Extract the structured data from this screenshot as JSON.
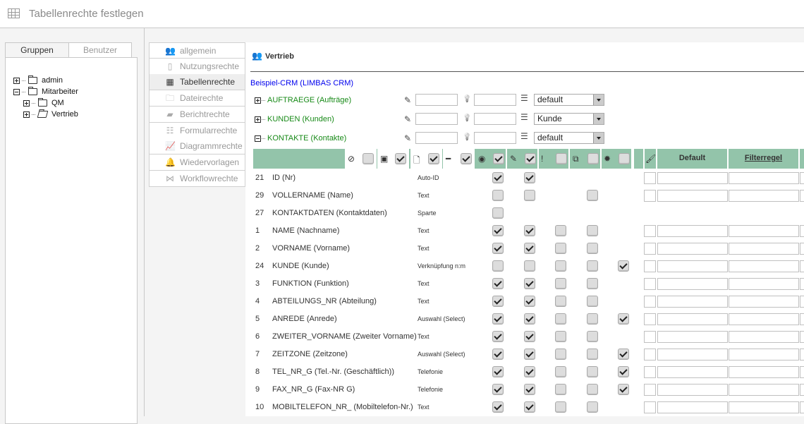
{
  "window": {
    "title": "Tabellenrechte festlegen",
    "icon": "table-icon"
  },
  "left_tabs": [
    {
      "label": "Gruppen",
      "active": true
    },
    {
      "label": "Benutzer",
      "active": false
    }
  ],
  "tree": [
    {
      "label": "admin",
      "expanded": false,
      "level": 0,
      "icon": "folder-icon"
    },
    {
      "label": "Mitarbeiter",
      "expanded": true,
      "level": 0,
      "icon": "folder-icon"
    },
    {
      "label": "QM",
      "expanded": false,
      "level": 1,
      "icon": "folder-icon"
    },
    {
      "label": "Vertrieb",
      "expanded": false,
      "level": 1,
      "icon": "folder-open-icon"
    }
  ],
  "menu": [
    {
      "label": "allgemein",
      "icon": "users-icon"
    },
    {
      "label": "Nutzungsrechte",
      "icon": "tablet-icon"
    },
    {
      "label": "Tabellenrechte",
      "icon": "table-icon",
      "active": true
    },
    {
      "label": "Dateirechte",
      "icon": "folder-icon"
    },
    {
      "label": "Berichtrechte",
      "icon": "book-icon"
    },
    {
      "label": "Formularrechte",
      "icon": "form-icon"
    },
    {
      "label": "Diagrammrechte",
      "icon": "chart-icon"
    },
    {
      "label": "Wiedervorlagen",
      "icon": "bell-icon"
    },
    {
      "label": "Workflowrechte",
      "icon": "workflow-icon"
    }
  ],
  "group_title": "Vertrieb",
  "database": "Beispiel-CRM (LIMBAS CRM)",
  "tables": [
    {
      "label": "AUFTRAEGE (Aufträge)",
      "expanded": false,
      "select": "default"
    },
    {
      "label": "KUNDEN (Kunden)",
      "expanded": false,
      "select": "Kunde"
    },
    {
      "label": "KONTAKTE (Kontakte)",
      "expanded": true,
      "select": "default"
    }
  ],
  "header": {
    "white_cols": [
      {
        "icon": "eye-slash-icon",
        "glyph": "⊘",
        "checked": false
      },
      {
        "icon": "save-icon",
        "glyph": "▣",
        "checked": true
      },
      {
        "icon": "add-file-icon",
        "glyph": "🗋",
        "checked": true
      },
      {
        "icon": "minus-icon",
        "glyph": "━",
        "checked": true
      }
    ],
    "green_cols": [
      {
        "icon": "eye-icon",
        "glyph": "◉",
        "checked": true
      },
      {
        "icon": "pencil-icon",
        "glyph": "✎",
        "checked": true
      },
      {
        "icon": "exclamation-icon",
        "glyph": "!",
        "checked": false
      },
      {
        "icon": "copy-icon",
        "glyph": "⧉",
        "checked": false
      },
      {
        "icon": "gear-icon",
        "glyph": "✹",
        "checked": false
      }
    ],
    "brush_icon": "brush-icon",
    "default_label": "Default",
    "filter_label": "Filterregel"
  },
  "colors": {
    "header_green": "#93c4aa",
    "table_green": "#188a18",
    "link_blue": "#0000ee"
  },
  "rows": [
    {
      "num": "21",
      "field": "ID (Nr)",
      "type": "Auto-ID",
      "cbs": [
        true,
        true,
        null,
        null,
        null
      ],
      "inputs": true
    },
    {
      "num": "29",
      "field": "VOLLERNAME (Name)",
      "type": "Text",
      "cbs": [
        false,
        false,
        null,
        false,
        null
      ],
      "inputs": true
    },
    {
      "num": "27",
      "field": "KONTAKTDATEN (Kontaktdaten)",
      "type": "Sparte",
      "cbs": [
        false,
        null,
        null,
        null,
        null
      ],
      "inputs": false
    },
    {
      "num": "1",
      "field": "NAME (Nachname)",
      "type": "Text",
      "cbs": [
        true,
        true,
        false,
        false,
        null
      ],
      "inputs": true
    },
    {
      "num": "2",
      "field": "VORNAME (Vorname)",
      "type": "Text",
      "cbs": [
        true,
        true,
        false,
        false,
        null
      ],
      "inputs": true
    },
    {
      "num": "24",
      "field": "KUNDE (Kunde)",
      "type": "Verknüpfung n:m",
      "cbs": [
        false,
        false,
        false,
        false,
        true
      ],
      "inputs": true
    },
    {
      "num": "3",
      "field": "FUNKTION (Funktion)",
      "type": "Text",
      "cbs": [
        true,
        true,
        false,
        false,
        null
      ],
      "inputs": true
    },
    {
      "num": "4",
      "field": "ABTEILUNGS_NR (Abteilung)",
      "type": "Text",
      "cbs": [
        true,
        true,
        false,
        false,
        null
      ],
      "inputs": true
    },
    {
      "num": "5",
      "field": "ANREDE (Anrede)",
      "type": "Auswahl (Select)",
      "cbs": [
        true,
        true,
        false,
        false,
        true
      ],
      "inputs": true
    },
    {
      "num": "6",
      "field": "ZWEITER_VORNAME (Zweiter Vorname)",
      "type": "Text",
      "cbs": [
        true,
        true,
        false,
        false,
        null
      ],
      "inputs": true
    },
    {
      "num": "7",
      "field": "ZEITZONE (Zeitzone)",
      "type": "Auswahl (Select)",
      "cbs": [
        true,
        true,
        false,
        false,
        true
      ],
      "inputs": true
    },
    {
      "num": "8",
      "field": "TEL_NR_G (Tel.-Nr. (Geschäftlich))",
      "type": "Telefonie",
      "cbs": [
        true,
        true,
        false,
        false,
        true
      ],
      "inputs": true
    },
    {
      "num": "9",
      "field": "FAX_NR_G (Fax-NR G)",
      "type": "Telefonie",
      "cbs": [
        true,
        true,
        false,
        false,
        true
      ],
      "inputs": true
    },
    {
      "num": "10",
      "field": "MOBILTELEFON_NR_ (Mobiltelefon-Nr.)",
      "type": "Text",
      "cbs": [
        true,
        true,
        false,
        false,
        null
      ],
      "inputs": true
    }
  ]
}
